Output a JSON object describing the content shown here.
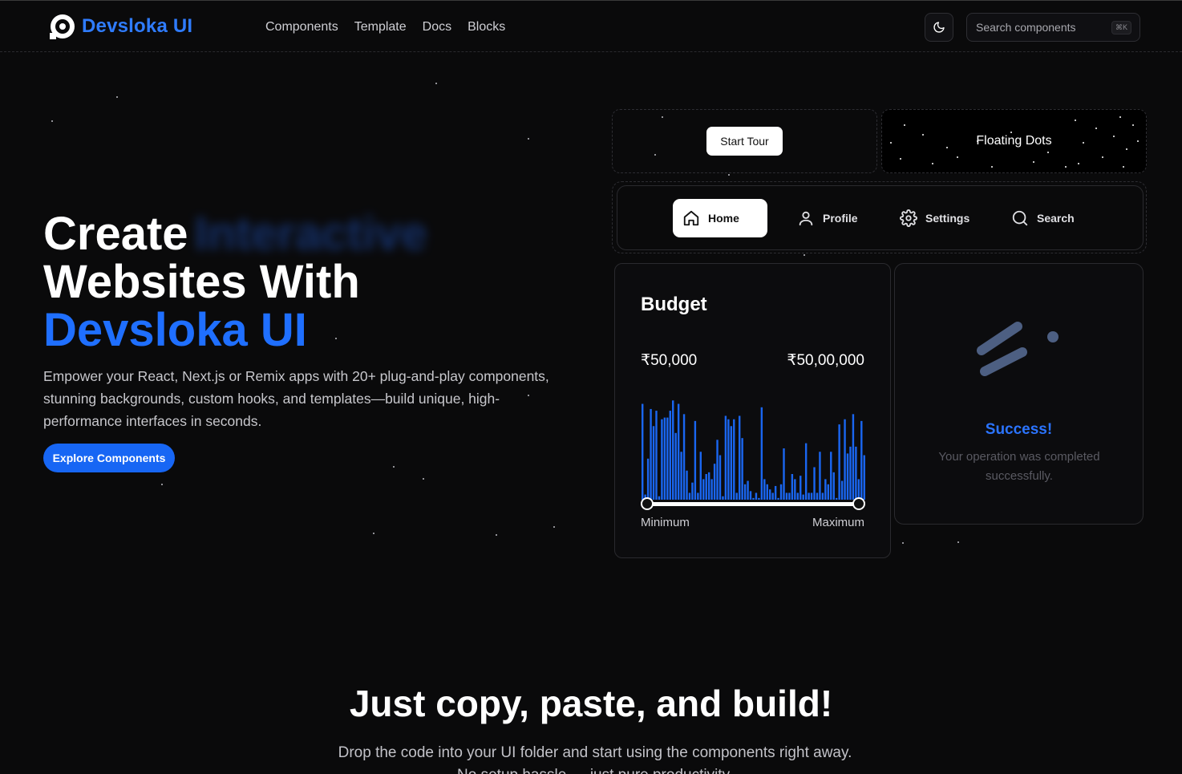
{
  "header": {
    "brand": "Devsloka UI",
    "nav": [
      "Components",
      "Template",
      "Docs",
      "Blocks"
    ],
    "search_placeholder": "Search components",
    "shortcut": "⌘K"
  },
  "hero": {
    "title_line1": "Create",
    "title_blur_word": "Interactive",
    "title_line2": "Websites With",
    "title_line3": "Devsloka UI",
    "description": "Empower your React, Next.js or Remix apps with 20+ plug-and-play components, stunning backgrounds, custom hooks, and templates—build unique, high-performance interfaces in seconds.",
    "cta": "Explore Components"
  },
  "demos": {
    "tour_button": "Start Tour",
    "floating_dots": "Floating Dots",
    "tabs": [
      {
        "label": "Home",
        "icon": "home-icon"
      },
      {
        "label": "Profile",
        "icon": "user-icon"
      },
      {
        "label": "Settings",
        "icon": "gear-icon"
      },
      {
        "label": "Search",
        "icon": "search-icon"
      }
    ],
    "budget": {
      "title": "Budget",
      "min_value": "₹50,000",
      "max_value": "₹50,00,000",
      "min_label": "Minimum",
      "max_label": "Maximum",
      "bars": [
        56,
        3,
        24,
        53,
        43,
        52,
        2,
        47,
        48,
        48,
        52,
        58,
        39,
        56,
        28,
        50,
        17,
        4,
        10,
        46,
        4,
        28,
        12,
        15,
        16,
        12,
        21,
        35,
        26,
        2,
        49,
        47,
        43,
        47,
        4,
        49,
        36,
        9,
        11,
        5,
        1,
        4,
        1,
        54,
        12,
        9,
        6,
        4,
        8,
        1,
        9,
        30,
        4,
        4,
        15,
        12,
        4,
        14,
        3,
        33,
        4,
        4,
        19,
        4,
        28,
        4,
        12,
        9,
        28,
        16,
        1,
        44,
        11,
        47,
        27,
        31,
        50,
        31,
        12,
        46,
        26
      ]
    },
    "success": {
      "title": "Success!",
      "message": "Your operation was completed successfully."
    }
  },
  "bottom": {
    "title": "Just copy, paste, and build!",
    "description": "Drop the code into your UI folder and start using the components right away. No setup hassle — just pure productivity."
  },
  "colors": {
    "accent": "#1766f4",
    "brand": "#2f7cff",
    "bar": "#1a66f0"
  }
}
